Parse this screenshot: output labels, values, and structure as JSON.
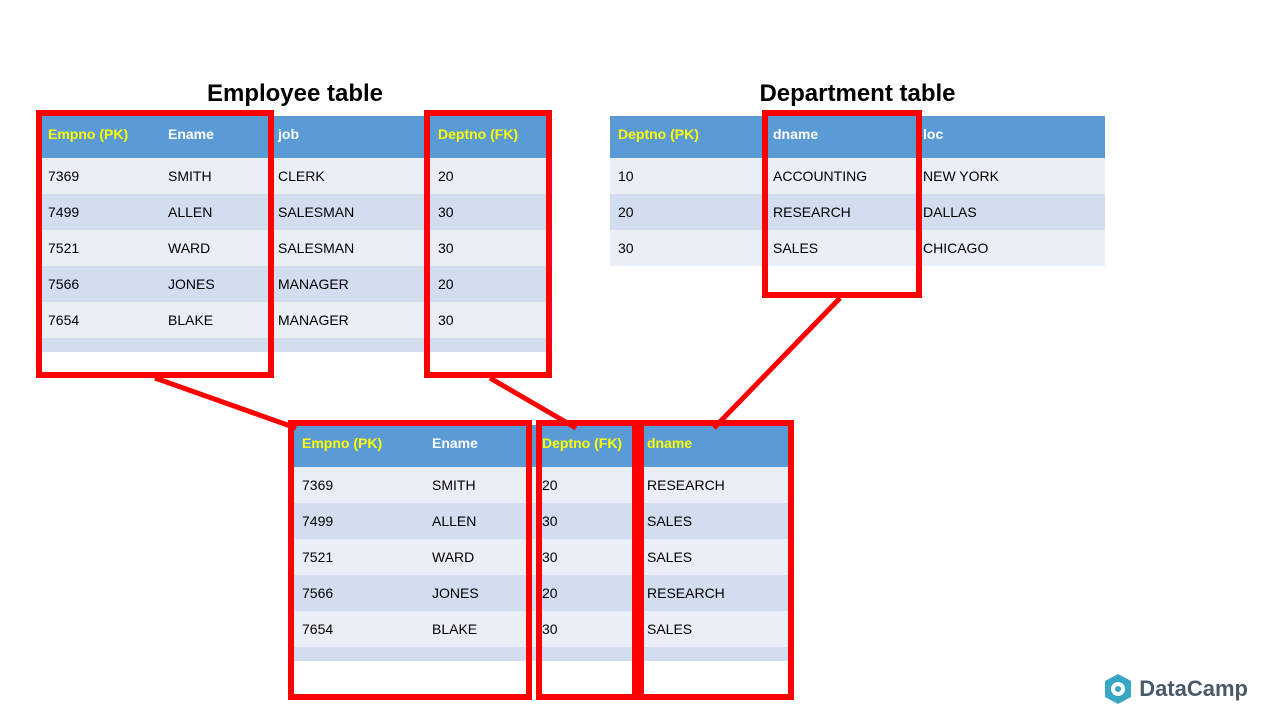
{
  "titles": {
    "employee": "Employee table",
    "department": "Department table"
  },
  "employee": {
    "headers": {
      "empno": "Empno (PK)",
      "ename": "Ename",
      "job": "job",
      "deptno": "Deptno (FK)"
    },
    "rows": [
      {
        "empno": "7369",
        "ename": "SMITH",
        "job": "CLERK",
        "deptno": "20"
      },
      {
        "empno": "7499",
        "ename": "ALLEN",
        "job": "SALESMAN",
        "deptno": "30"
      },
      {
        "empno": "7521",
        "ename": "WARD",
        "job": "SALESMAN",
        "deptno": "30"
      },
      {
        "empno": "7566",
        "ename": "JONES",
        "job": "MANAGER",
        "deptno": "20"
      },
      {
        "empno": "7654",
        "ename": "BLAKE",
        "job": "MANAGER",
        "deptno": "30"
      }
    ]
  },
  "department": {
    "headers": {
      "deptno": "Deptno (PK)",
      "dname": "dname",
      "loc": "loc"
    },
    "rows": [
      {
        "deptno": "10",
        "dname": "ACCOUNTING",
        "loc": "NEW YORK"
      },
      {
        "deptno": "20",
        "dname": "RESEARCH",
        "loc": "DALLAS"
      },
      {
        "deptno": "30",
        "dname": "SALES",
        "loc": "CHICAGO"
      }
    ]
  },
  "joined": {
    "headers": {
      "empno": "Empno (PK)",
      "ename": "Ename",
      "deptno": "Deptno (FK)",
      "dname": "dname"
    },
    "rows": [
      {
        "empno": "7369",
        "ename": "SMITH",
        "deptno": "20",
        "dname": "RESEARCH"
      },
      {
        "empno": "7499",
        "ename": "ALLEN",
        "deptno": "30",
        "dname": "SALES"
      },
      {
        "empno": "7521",
        "ename": "WARD",
        "deptno": "30",
        "dname": "SALES"
      },
      {
        "empno": "7566",
        "ename": "JONES",
        "deptno": "20",
        "dname": "RESEARCH"
      },
      {
        "empno": "7654",
        "ename": "BLAKE",
        "deptno": "30",
        "dname": "SALES"
      }
    ]
  },
  "logo": {
    "text": "DataCamp"
  }
}
